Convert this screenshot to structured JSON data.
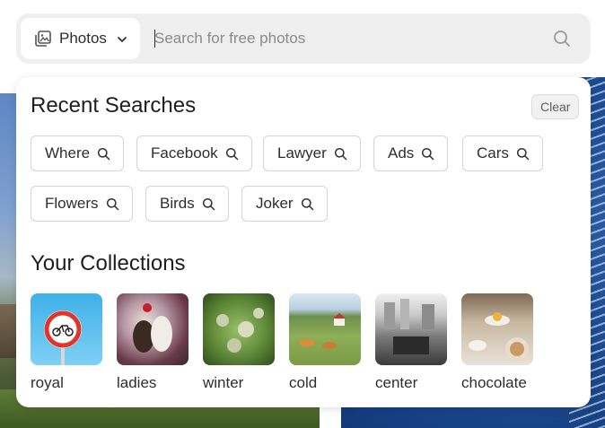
{
  "search": {
    "type_label": "Photos",
    "placeholder": "Search for free photos",
    "value": ""
  },
  "recent": {
    "title": "Recent Searches",
    "clear_label": "Clear",
    "items": [
      "Where",
      "Facebook",
      "Lawyer",
      "Ads",
      "Cars",
      "Flowers",
      "Birds",
      "Joker"
    ]
  },
  "collections": {
    "title": "Your Collections",
    "items": [
      {
        "name": "royal"
      },
      {
        "name": "ladies"
      },
      {
        "name": "winter"
      },
      {
        "name": "cold"
      },
      {
        "name": "center"
      },
      {
        "name": "chocolate"
      }
    ]
  },
  "icons": {
    "type_icon": "image-gallery-icon",
    "dropdown_icon": "chevron-down-icon",
    "search_icon": "search-icon"
  },
  "colors": {
    "search_bar_bg": "#efefef",
    "panel_bg": "#ffffff",
    "chip_border": "#d4d4d4",
    "text": "#2e2e2e"
  }
}
